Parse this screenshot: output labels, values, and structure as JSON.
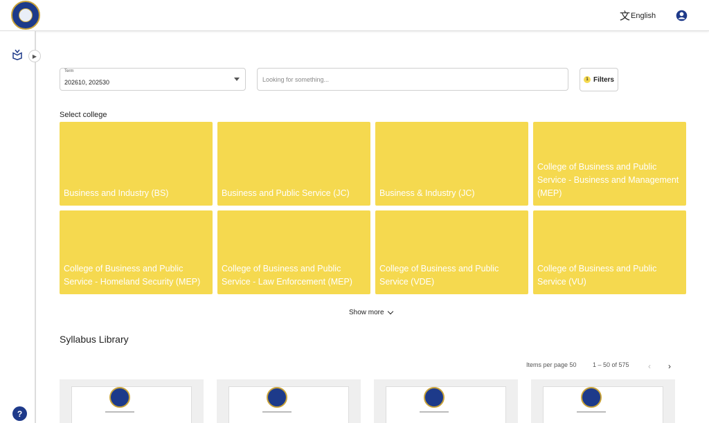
{
  "header": {
    "language_label": "English",
    "language_icon": "translate-icon",
    "account_icon": "account-circle-icon"
  },
  "sidebar": {
    "book_icon": "book-icon",
    "toggle_icon": "chevron-right-icon",
    "help_label": "?"
  },
  "filters": {
    "term_label": "Term",
    "term_value": "202610, 202530",
    "search_placeholder": "Looking for something...",
    "filters_count": "1",
    "filters_label": "Filters"
  },
  "colleges": {
    "title": "Select college",
    "items": [
      {
        "label": "Business and Industry (BS)"
      },
      {
        "label": "Business and Public Service (JC)"
      },
      {
        "label": "Business & Industry (JC)"
      },
      {
        "label": "College of Business and Public Service - Business and Management (MEP)"
      },
      {
        "label": "College of Business and Public Service - Homeland Security (MEP)"
      },
      {
        "label": "College of Business and Public Service - Law Enforcement (MEP)"
      },
      {
        "label": "College of Business and Public Service (VDE)"
      },
      {
        "label": "College of Business and Public Service (VU)"
      }
    ],
    "show_more_label": "Show more",
    "card_color": "#f5d94f"
  },
  "library": {
    "title": "Syllabus Library",
    "items_per_page_label": "Items per page 50",
    "range_label": "1 – 50 of 575",
    "prev_icon": "‹",
    "next_icon": "›"
  },
  "colors": {
    "accent": "#1e3a8a",
    "card": "#f5d94f"
  }
}
